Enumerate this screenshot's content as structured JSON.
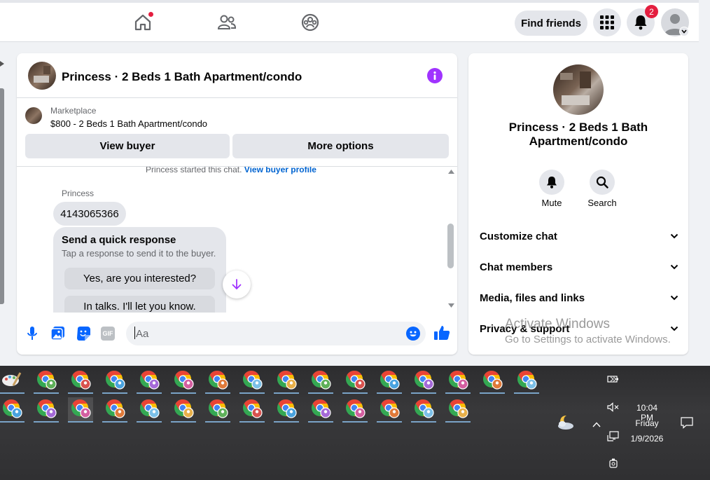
{
  "topnav": {
    "find_friends": "Find friends",
    "notification_count": "2"
  },
  "chat": {
    "title": "Princess · 2 Beds 1 Bath Apartment/condo",
    "marketplace_label": "Marketplace",
    "listing": "$800 - 2 Beds 1 Bath Apartment/condo",
    "view_buyer": "View buyer",
    "more_options": "More options",
    "started_text": "Princess started this chat.",
    "view_buyer_profile": "View buyer profile",
    "sender_name": "Princess",
    "message": "4143065366",
    "quick_title": "Send a quick response",
    "quick_sub": "Tap a response to send it to the buyer.",
    "quick_responses": [
      "Yes, are you interested?",
      "In talks. I'll let you know."
    ],
    "input_placeholder": "Aa",
    "gif_label": "GIF"
  },
  "info": {
    "name": "Princess · 2 Beds 1 Bath Apartment/condo",
    "mute": "Mute",
    "search": "Search",
    "sections": [
      "Customize chat",
      "Chat members",
      "Media, files and links",
      "Privacy & support"
    ]
  },
  "watermark": {
    "title": "Activate Windows",
    "sub": "Go to Settings to activate Windows."
  },
  "tray": {
    "time": "10:04 PM",
    "day": "Friday",
    "date": "1/9/2026"
  },
  "colors": {
    "accent": "#0866ff",
    "purple": "#a033ff",
    "badge": "#e41e3f"
  }
}
